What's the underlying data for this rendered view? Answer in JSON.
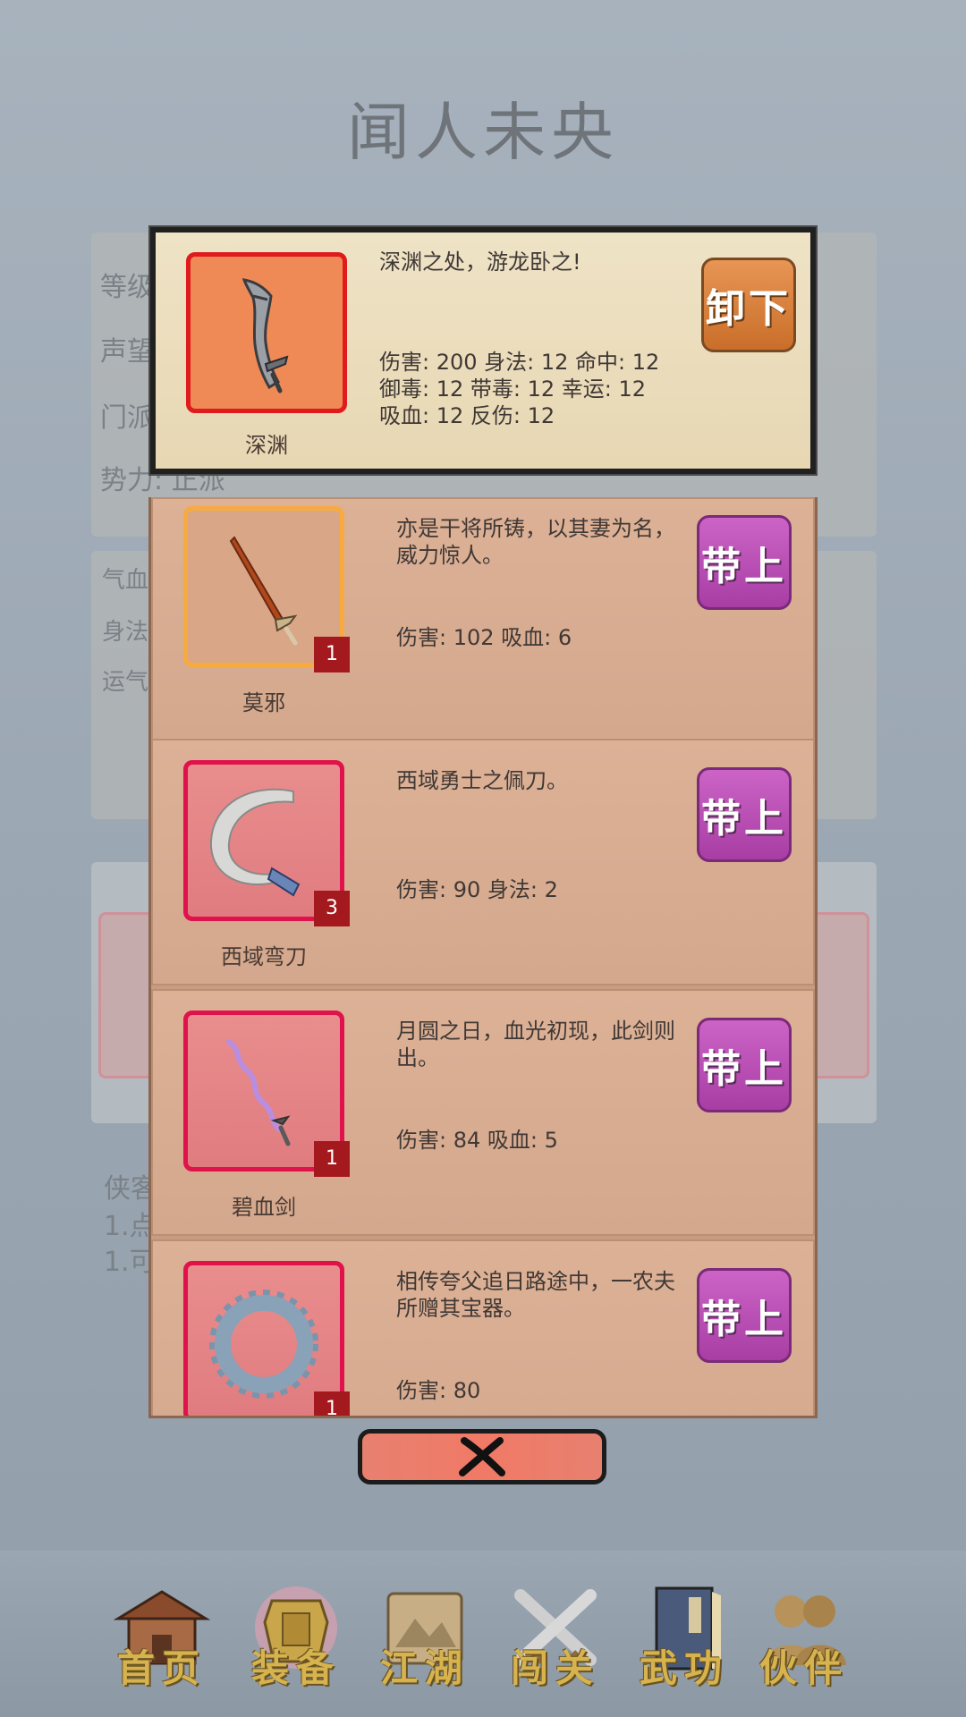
{
  "background": {
    "title": "闻人未央",
    "info_rows": [
      "等级",
      "声望",
      "门派",
      "势力: 正派"
    ],
    "stat_rows": [
      "气血",
      "身法",
      "运气"
    ],
    "notes": [
      "侠客",
      "1.点",
      "1.可"
    ]
  },
  "equipped": {
    "name": "深渊",
    "icon": "dark-sword-icon",
    "description": "深渊之处，游龙卧之!",
    "stats": [
      "伤害: 200 身法: 12 命中: 12",
      "御毒: 12 带毒: 12 幸运: 12",
      "吸血: 12 反伤: 12"
    ],
    "button_label": "卸下"
  },
  "items": [
    {
      "name": "莫邪",
      "icon": "bronze-sword-icon",
      "count": "1",
      "rarity": "orange",
      "description": "亦是干将所铸，以其妻为名，威力惊人。",
      "stats": [
        "伤害: 102 吸血: 6"
      ],
      "button_label": "带上"
    },
    {
      "name": "西域弯刀",
      "icon": "scimitar-icon",
      "count": "3",
      "rarity": "red",
      "description": "西域勇士之佩刀。",
      "stats": [
        "伤害: 90 身法: 2"
      ],
      "button_label": "带上"
    },
    {
      "name": "碧血剑",
      "icon": "purple-blade-icon",
      "count": "1",
      "rarity": "red",
      "description": "月圆之日，血光初现，此剑则出。",
      "stats": [
        "伤害: 84 吸血: 5"
      ],
      "button_label": "带上"
    },
    {
      "name": "",
      "icon": "chakram-icon",
      "count": "1",
      "rarity": "red",
      "description": "相传夸父追日路途中，一农夫所赠其宝器。",
      "stats": [
        "伤害: 80"
      ],
      "button_label": "带上"
    }
  ],
  "close_icon": "close-x-icon",
  "nav": [
    {
      "label": "首页",
      "icon": "house-icon"
    },
    {
      "label": "装备",
      "icon": "armor-icon"
    },
    {
      "label": "江湖",
      "icon": "scroll-map-icon"
    },
    {
      "label": "闯关",
      "icon": "crossed-swords-icon"
    },
    {
      "label": "武功",
      "icon": "book-icon"
    },
    {
      "label": "伙伴",
      "icon": "companions-icon"
    }
  ],
  "colors": {
    "equip_button": "#b04cab",
    "unequip_button": "#d47a37",
    "badge": "#a3191d",
    "nav_label": "#d6b34e"
  }
}
